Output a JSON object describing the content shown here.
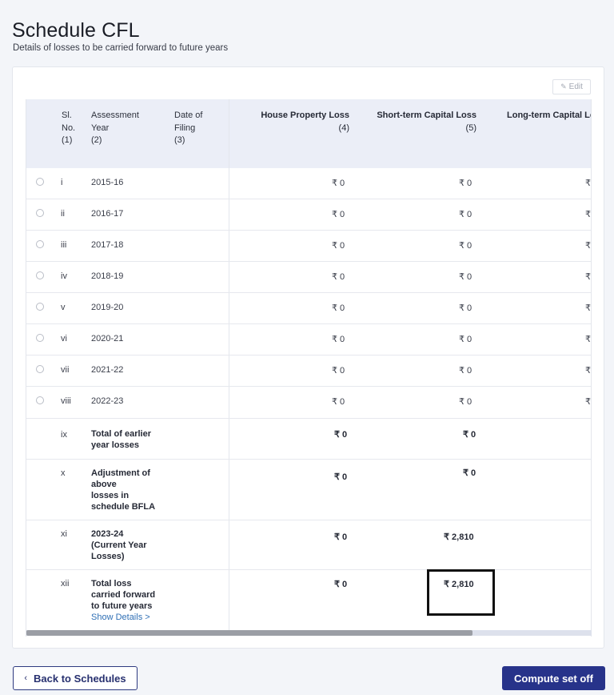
{
  "page": {
    "title": "Schedule CFL",
    "subtitle": "Details of losses to be carried forward to future years"
  },
  "toolbar": {
    "edit_label": "Edit",
    "edit_icon": "pencil-icon"
  },
  "table": {
    "headers": {
      "sl_no": [
        "Sl.",
        "No.",
        "(1)"
      ],
      "assessment_year": [
        "Assessment",
        "Year",
        "(2)"
      ],
      "date_of_filing": [
        "Date of",
        "Filing",
        "(3)"
      ],
      "house_property_loss": [
        "House Property Loss",
        "(4)"
      ],
      "short_term_capital_loss": [
        "Short-term Capital Loss",
        "(5)"
      ],
      "long_term_capital_loss": [
        "Long-term Capital Lo"
      ]
    },
    "rows": [
      {
        "sl": "i",
        "year": "2015-16",
        "hpl": "₹ 0",
        "stcl": "₹ 0",
        "ltcl": "₹"
      },
      {
        "sl": "ii",
        "year": "2016-17",
        "hpl": "₹ 0",
        "stcl": "₹ 0",
        "ltcl": "₹"
      },
      {
        "sl": "iii",
        "year": "2017-18",
        "hpl": "₹ 0",
        "stcl": "₹ 0",
        "ltcl": "₹"
      },
      {
        "sl": "iv",
        "year": "2018-19",
        "hpl": "₹ 0",
        "stcl": "₹ 0",
        "ltcl": "₹"
      },
      {
        "sl": "v",
        "year": "2019-20",
        "hpl": "₹ 0",
        "stcl": "₹ 0",
        "ltcl": "₹"
      },
      {
        "sl": "vi",
        "year": "2020-21",
        "hpl": "₹ 0",
        "stcl": "₹ 0",
        "ltcl": "₹"
      },
      {
        "sl": "vii",
        "year": "2021-22",
        "hpl": "₹ 0",
        "stcl": "₹ 0",
        "ltcl": "₹"
      },
      {
        "sl": "viii",
        "year": "2022-23",
        "hpl": "₹ 0",
        "stcl": "₹ 0",
        "ltcl": "₹"
      }
    ],
    "summary_rows": [
      {
        "sl": "ix",
        "label": [
          "Total of earlier",
          "year losses"
        ],
        "hpl": "₹ 0",
        "stcl": "₹ 0"
      },
      {
        "sl": "x",
        "label": [
          "Adjustment of",
          "above",
          "losses in",
          "schedule BFLA"
        ],
        "hpl": "₹ 0",
        "stcl": "₹ 0"
      },
      {
        "sl": "xi",
        "label": [
          "2023-24",
          "(Current Year",
          "Losses)"
        ],
        "hpl": "₹ 0",
        "stcl": "₹ 2,810"
      },
      {
        "sl": "xii",
        "label": [
          "Total loss",
          "carried forward",
          "to future years"
        ],
        "link": "Show Details >",
        "hpl": "₹ 0",
        "stcl": "₹ 2,810"
      }
    ]
  },
  "footer": {
    "back_label": "Back to Schedules",
    "back_icon": "chevron-left-icon",
    "compute_label": "Compute set off"
  },
  "colors": {
    "primary": "#27338a",
    "header_bg": "#ebeef7",
    "link": "#2f6fb5",
    "page_bg": "#f3f5f9"
  }
}
